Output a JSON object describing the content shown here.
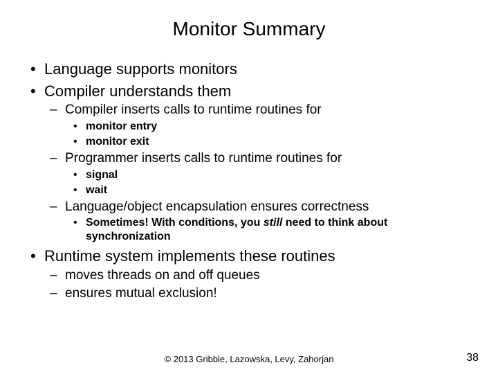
{
  "title": "Monitor Summary",
  "b1": "Language supports monitors",
  "b2": "Compiler understands them",
  "b2a": "Compiler inserts calls to runtime routines for",
  "b2a1": "monitor entry",
  "b2a2": "monitor exit",
  "b2b": "Programmer inserts calls to runtime routines for",
  "b2b1": "signal",
  "b2b2": "wait",
  "b2c": "Language/object encapsulation ensures correctness",
  "b2c1_pre": "Sometimes!  With conditions, you ",
  "b2c1_em": "still",
  "b2c1_post": " need to think about synchronization",
  "b3": "Runtime system implements these routines",
  "b3a": "moves threads on and off queues",
  "b3b": "ensures mutual exclusion!",
  "footer": "© 2013 Gribble, Lazowska, Levy, Zahorjan",
  "page": "38"
}
